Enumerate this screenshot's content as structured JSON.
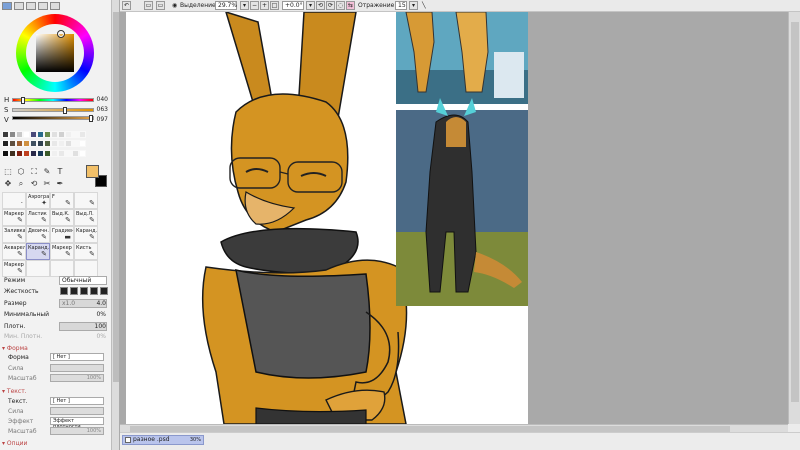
{
  "toolbar": {
    "selection_label": "Выделение",
    "zoom": "29.7%",
    "rotation": "+0.0°",
    "mirror_label": "Отражение",
    "stabilizer": "15"
  },
  "color": {
    "h_label": "H",
    "h_value": "040",
    "s_label": "S",
    "s_value": "063",
    "v_label": "V",
    "v_value": "097",
    "foreground": "#f2c069",
    "background": "#000000"
  },
  "swatches": [
    "#3a3a3a",
    "#8a8a8a",
    "#c8c8c8",
    "#ffffff",
    "#4a4a7a",
    "#2a6a8a",
    "#6a8a4a",
    "#e0e0e0",
    "#d0d0d0",
    "#f0f0f0",
    "#f8f8f8",
    "#e8e8e8",
    "#202020",
    "#605040",
    "#a06030",
    "#d09040",
    "#405060",
    "#304050",
    "#506040",
    "#e8e8e8",
    "#f0f0f0",
    "#e0e0e0",
    "#f8f8f8",
    "#ffffff",
    "#101010",
    "#403020",
    "#802010",
    "#c04020",
    "#2a2a4a",
    "#1a3a5a",
    "#3a5a2a",
    "#f0f0f0",
    "#e8e8e8",
    "#f8f8f8",
    "#e0e0e0",
    "#ffffff"
  ],
  "tools": [
    "⬚",
    "⬡",
    "⛶",
    "✎",
    "T",
    "✥",
    "⌕",
    "⟲",
    "✂",
    "✒"
  ],
  "brushes": [
    {
      "name": "",
      "icon": "·"
    },
    {
      "name": "Аэрограф",
      "icon": "✦"
    },
    {
      "name": "F",
      "icon": "✎"
    },
    {
      "name": "",
      "icon": "✎"
    },
    {
      "name": "Маркер",
      "icon": "✎"
    },
    {
      "name": "Ластик",
      "icon": "✎"
    },
    {
      "name": "Выд.К.",
      "icon": "✎"
    },
    {
      "name": "Выд.Л.",
      "icon": "✎"
    },
    {
      "name": "Заливка",
      "icon": "✎"
    },
    {
      "name": "Двоичн.",
      "icon": "✎"
    },
    {
      "name": "Градиент",
      "icon": "▬"
    },
    {
      "name": "Каранд.",
      "icon": "✎"
    },
    {
      "name": "Акварель",
      "icon": "✎"
    },
    {
      "name": "Каранд.",
      "icon": "✎"
    },
    {
      "name": "Маркер",
      "icon": "✎"
    },
    {
      "name": "Кисть",
      "icon": "✎"
    },
    {
      "name": "Маркер",
      "icon": "✎"
    },
    {
      "name": "",
      "icon": ""
    },
    {
      "name": "",
      "icon": ""
    },
    {
      "name": "",
      "icon": ""
    }
  ],
  "props": {
    "mode_label": "Режим",
    "mode_value": "Обычный",
    "hardness_label": "Жесткость",
    "size_label": "Размер",
    "size_mult": "x1.0",
    "size_value": "4.0",
    "minsize_label": "Минимальный",
    "minsize_value": "0%",
    "density_label": "Плотн.",
    "density_value": "100",
    "maxdensity_label": "Мин. Плотн.",
    "maxdensity_value": "0%"
  },
  "shape_section": {
    "title": "Форма",
    "form_label": "Форма",
    "form_value": "[ Нет ]",
    "strength_label": "Сила",
    "scale_label": "Масштаб",
    "scale_value": "100%"
  },
  "texture_section": {
    "title": "Текст.",
    "tex_label": "Текст.",
    "tex_value": "[ Нет ]",
    "strength_label": "Сила",
    "effect_label": "Эффект",
    "effect_value": "Эффект плотности",
    "scale_label": "Масштаб",
    "scale_value": "100%"
  },
  "more_section": {
    "title": "Опции"
  },
  "file": {
    "name": "разное .psd",
    "zoom": "30%"
  }
}
